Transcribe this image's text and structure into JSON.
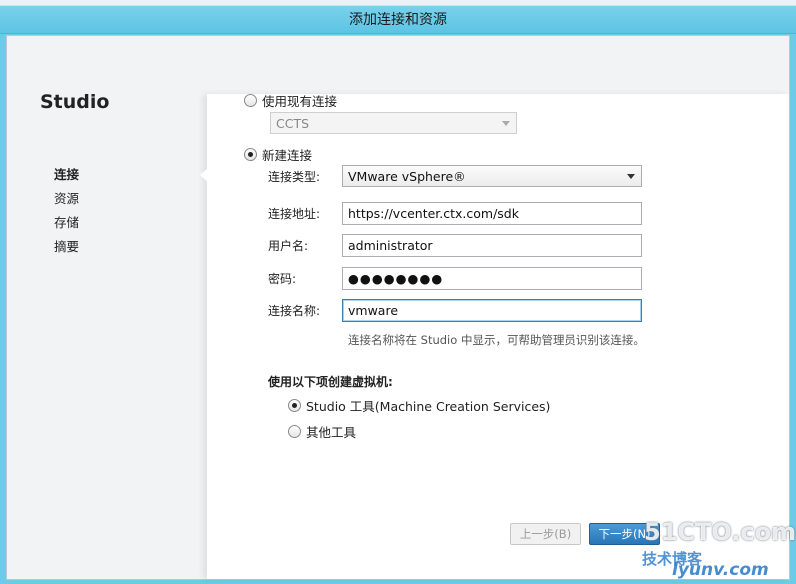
{
  "window": {
    "title": "添加连接和资源"
  },
  "sidebar": {
    "brand": "Studio",
    "items": [
      {
        "label": "连接",
        "active": true
      },
      {
        "label": "资源",
        "active": false
      },
      {
        "label": "存储",
        "active": false
      },
      {
        "label": "摘要",
        "active": false
      }
    ]
  },
  "form": {
    "use_existing": {
      "label": "使用现有连接",
      "selected": false,
      "dropdown_value": "CCTS"
    },
    "create_new": {
      "label": "新建连接",
      "selected": true
    },
    "connection_type": {
      "label": "连接类型:",
      "value": "VMware vSphere®"
    },
    "connection_address": {
      "label": "连接地址:",
      "value": "https://vcenter.ctx.com/sdk"
    },
    "username": {
      "label": "用户名:",
      "value": "administrator"
    },
    "password": {
      "label": "密码:",
      "value": "●●●●●●●●"
    },
    "connection_name": {
      "label": "连接名称:",
      "value": "vmware"
    },
    "name_hint": "连接名称将在 Studio 中显示，可帮助管理员识别该连接。",
    "create_vm_section": "使用以下项创建虚拟机:",
    "studio_tools": {
      "label": "Studio 工具(Machine Creation Services)",
      "selected": true
    },
    "other_tools": {
      "label": "其他工具",
      "selected": false
    }
  },
  "buttons": {
    "back": "上一步(B)",
    "next": "下一步(N)"
  },
  "watermark": {
    "line1": "51CTO.com",
    "line2": "技术博客",
    "line3": "lyunv.com"
  }
}
